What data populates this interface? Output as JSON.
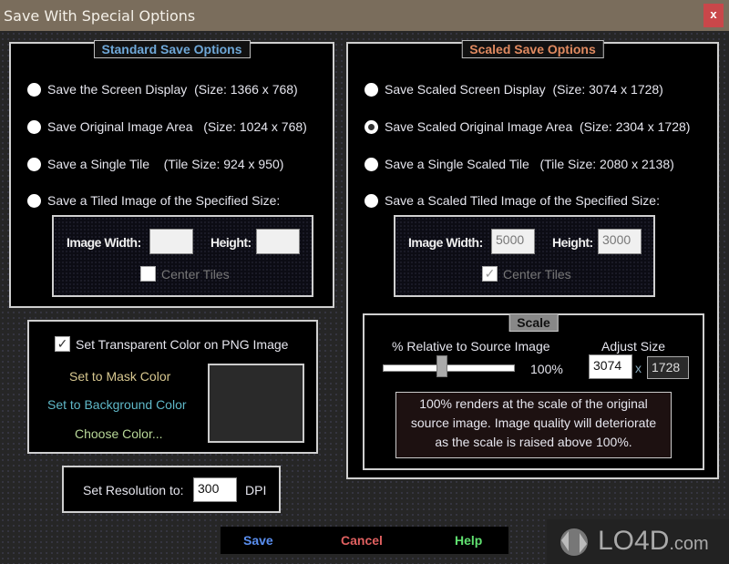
{
  "window": {
    "title": "Save With Special Options",
    "close_label": "x"
  },
  "standard": {
    "legend": "Standard Save Options",
    "legend_color": "#6fa8d8",
    "options": [
      {
        "label": "Save the Screen Display",
        "detail": "(Size:  1366 x 768)",
        "checked": false
      },
      {
        "label": "Save Original Image Area",
        "detail": "(Size:  1024 x 768)",
        "checked": false
      },
      {
        "label": "Save a Single Tile",
        "detail": "(Tile Size:  924 x 950)",
        "checked": false
      },
      {
        "label": "Save a Tiled Image of the Specified Size:",
        "detail": "",
        "checked": false
      }
    ],
    "tiled": {
      "width_label": "Image Width:",
      "width_value": "",
      "height_label": "Height:",
      "height_value": "",
      "center_tiles_label": "Center Tiles",
      "center_tiles_checked": false
    }
  },
  "scaled": {
    "legend": "Scaled Save Options",
    "legend_color": "#e08a60",
    "options": [
      {
        "label": "Save Scaled Screen Display",
        "detail": "(Size:  3074 x 1728)",
        "checked": false
      },
      {
        "label": "Save Scaled Original Image Area",
        "detail": "(Size:  2304 x 1728)",
        "checked": true
      },
      {
        "label": "Save a Single Scaled Tile",
        "detail": "(Tile Size:  2080 x 2138)",
        "checked": false
      },
      {
        "label": "Save a Scaled Tiled Image of the Specified Size:",
        "detail": "",
        "checked": false
      }
    ],
    "tiled": {
      "width_label": "Image Width:",
      "width_value": "5000",
      "height_label": "Height:",
      "height_value": "3000",
      "center_tiles_label": "Center Tiles",
      "center_tiles_checked": true
    },
    "scale": {
      "legend": "Scale",
      "relative_label": "% Relative to Source Image",
      "slider_fraction": 0.45,
      "percent_value": "100%",
      "adjust_label": "Adjust Size",
      "width_value": "3074",
      "times": "x",
      "height_value": "1728",
      "note": "100% renders at the scale of the original source image.  Image quality will deteriorate as the scale is raised above 100%."
    }
  },
  "transparency": {
    "checkbox_label": "Set Transparent Color on PNG Image",
    "checked": true,
    "mask_link": "Set to Mask Color",
    "mask_color": "#d8c890",
    "background_link": "Set to Background Color",
    "background_color": "#5fb8c8",
    "choose_link": "Choose Color...",
    "choose_color": "#b8d898"
  },
  "resolution": {
    "label": "Set Resolution to:",
    "value": "300",
    "unit": "DPI"
  },
  "buttons": {
    "save": "Save",
    "save_color": "#5a8ff0",
    "cancel": "Cancel",
    "cancel_color": "#e06060",
    "help": "Help",
    "help_color": "#60e070"
  },
  "watermark": {
    "text": "LO4D",
    "suffix": ".com"
  }
}
